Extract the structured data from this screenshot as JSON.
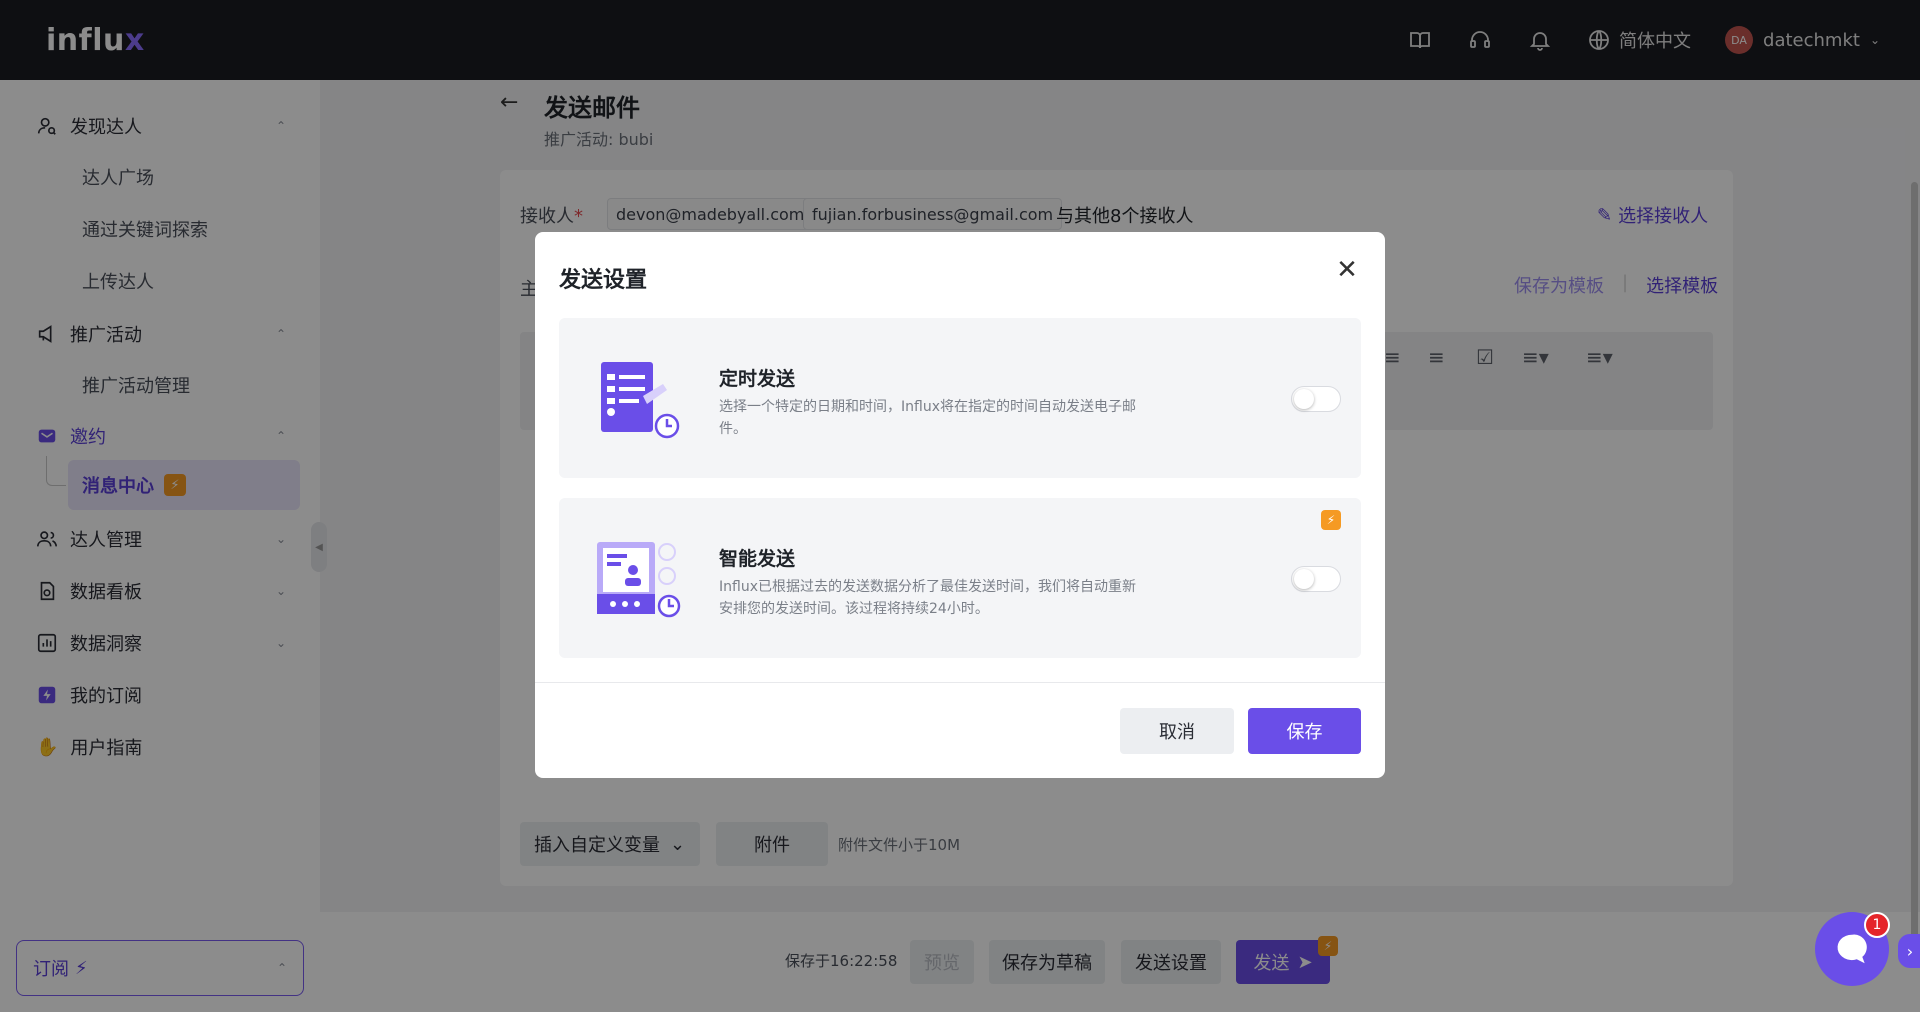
{
  "header": {
    "logo_main": "influ",
    "logo_x": "x",
    "language": "简体中文",
    "avatar_initials": "DA",
    "username": "datechmkt"
  },
  "sidebar": {
    "groups": [
      {
        "label": "发现达人",
        "icon": "user-search-icon"
      },
      {
        "label": "推广活动",
        "icon": "megaphone-icon"
      },
      {
        "label": "邀约",
        "icon": "mail-icon"
      },
      {
        "label": "达人管理",
        "icon": "users-icon"
      },
      {
        "label": "数据看板",
        "icon": "dashboard-icon"
      },
      {
        "label": "数据洞察",
        "icon": "chart-icon"
      },
      {
        "label": "我的订阅",
        "icon": "bolt-icon"
      },
      {
        "label": "用户指南",
        "icon": "hand-icon"
      }
    ],
    "sub_items": {
      "discover": [
        "达人广场",
        "通过关键词探索",
        "上传达人"
      ],
      "campaign": [
        "推广活动管理"
      ],
      "invite_active": "消息中心"
    },
    "subscribe_label": "订阅"
  },
  "page": {
    "title": "发送邮件",
    "subtitle": "推广活动: bubi",
    "recipients_label": "接收人",
    "recipients_required": "*",
    "recipient_chips": [
      "devon@madebyall.com",
      "fujian.forbusiness@gmail.com"
    ],
    "others_text": "与其他8个接收人",
    "pick_recipients": "选择接收人",
    "subject_label": "主",
    "save_template": "保存为模板",
    "choose_template": "选择模板",
    "insert_var": "插入自定义变量",
    "attach": "附件",
    "attach_note": "附件文件小于10M"
  },
  "footer": {
    "saved_at": "保存于16:22:58",
    "preview": "预览",
    "save_draft": "保存为草稿",
    "send_settings": "发送设置",
    "send": "发送"
  },
  "chat": {
    "unread": "1"
  },
  "modal": {
    "title": "发送设置",
    "options": [
      {
        "title": "定时发送",
        "desc": "选择一个特定的日期和时间，Influx将在指定的时间自动发送电子邮件。",
        "enabled": false
      },
      {
        "title": "智能发送",
        "desc": "Influx已根据过去的发送数据分析了最佳发送时间，我们将自动重新安排您的发送时间。该过程将持续24小时。",
        "enabled": false,
        "premium": true
      }
    ],
    "cancel": "取消",
    "save": "保存"
  },
  "colors": {
    "accent": "#6a4ee8",
    "topbar": "#1b1c22",
    "badge": "#f59a23"
  }
}
